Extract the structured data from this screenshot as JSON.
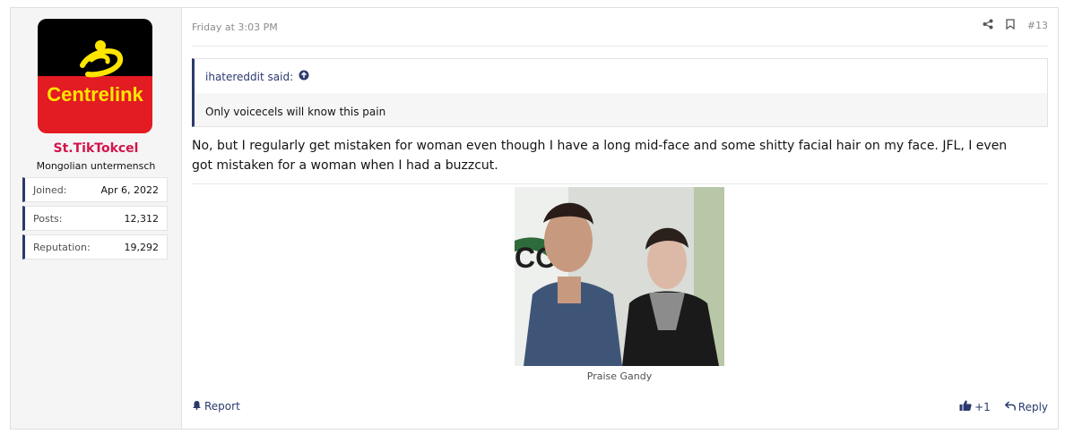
{
  "post": {
    "date": "Friday at 3:03 PM",
    "post_number": "#13",
    "body": "No, but I regularly get mistaken for woman even though I have a long mid-face and some shitty facial hair on my face. JFL, I even got mistaken for a woman when I had a buzzcut.",
    "image_caption": "Praise Gandy"
  },
  "user": {
    "avatar_logo_text": "Centrelink",
    "name": "St.TikTokcel",
    "title": "Mongolian untermensch",
    "stats": [
      {
        "label": "Joined:",
        "value": "Apr 6, 2022"
      },
      {
        "label": "Posts:",
        "value": "12,312"
      },
      {
        "label": "Reputation:",
        "value": "19,292"
      }
    ]
  },
  "quote": {
    "author": "ihatereddit said:",
    "text": "Only voicecels will know this pain"
  },
  "footer": {
    "report_label": "Report",
    "reaction_count": "+1",
    "reply_label": "Reply"
  },
  "icons": {
    "share": "share-icon",
    "bookmark": "bookmark-icon",
    "quote_up": "arrow-up-circle-icon",
    "report": "bell-icon",
    "like": "thumbs-up-icon",
    "reply": "reply-arrow-icon"
  },
  "colors": {
    "username": "#d3154b",
    "accent": "#2a3a6e",
    "avatar_top": "#000000",
    "avatar_bottom": "#e31b23",
    "avatar_text": "#ffe600"
  }
}
